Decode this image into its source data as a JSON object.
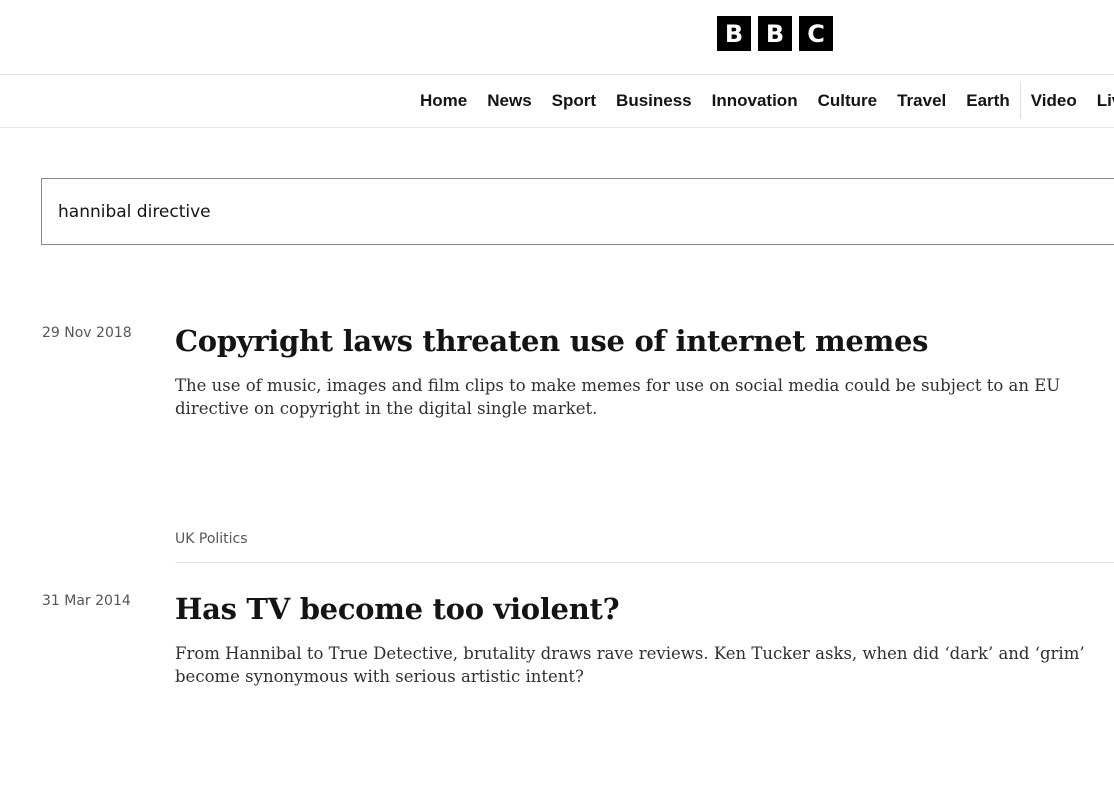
{
  "logo": {
    "letters": [
      "B",
      "B",
      "C"
    ]
  },
  "nav": {
    "items": [
      "Home",
      "News",
      "Sport",
      "Business",
      "Innovation",
      "Culture",
      "Travel",
      "Earth",
      "Video",
      "Live"
    ]
  },
  "search": {
    "value": "hannibal directive"
  },
  "results": [
    {
      "date": "29 Nov 2018",
      "title": "Copyright laws threaten use of internet memes",
      "description": "The use of music, images and film clips to make memes for use on social media could be subject to an EU directive on copyright in the digital single market."
    },
    {
      "category": "UK Politics",
      "date": "31 Mar 2014",
      "title": "Has TV become too violent?",
      "description": "From Hannibal to True Detective, brutality draws rave reviews. Ken Tucker asks, when did ‘dark’ and ‘grim’ become synonymous with serious artistic intent?"
    }
  ]
}
